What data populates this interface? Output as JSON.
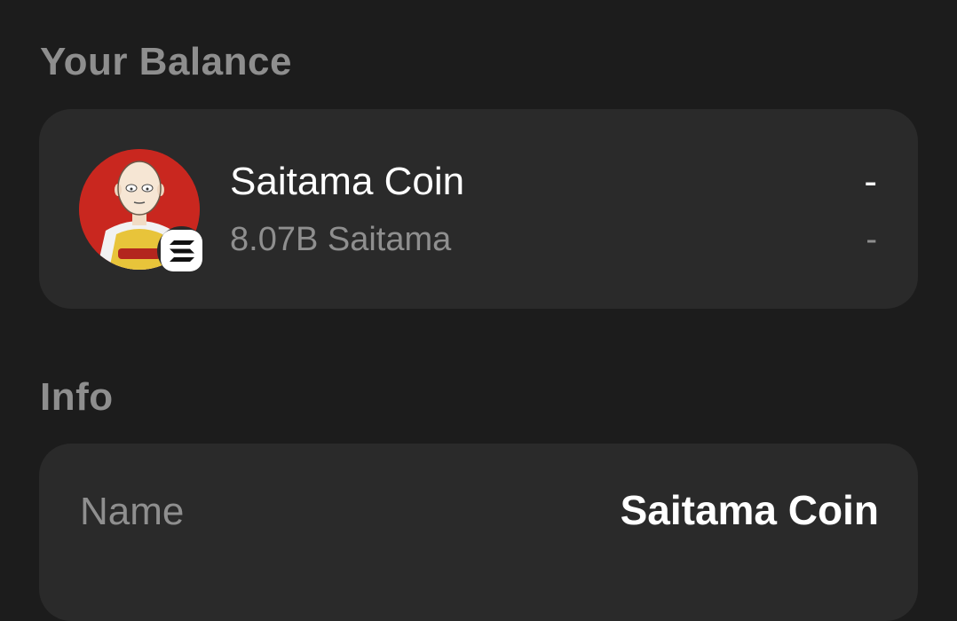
{
  "balance_section": {
    "title": "Your Balance",
    "token": {
      "name": "Saitama Coin",
      "amount": "8.07B Saitama",
      "value": "-",
      "change": "-",
      "avatar_icon": "saitama-avatar-icon",
      "chain_icon": "solana-icon"
    }
  },
  "info_section": {
    "title": "Info",
    "rows": [
      {
        "label": "Name",
        "value": "Saitama Coin"
      }
    ]
  },
  "colors": {
    "background": "#1c1c1c",
    "card": "#2a2a2a",
    "primary_text": "#ffffff",
    "secondary_text": "#8f8f8f",
    "avatar_bg": "#c9271f"
  }
}
